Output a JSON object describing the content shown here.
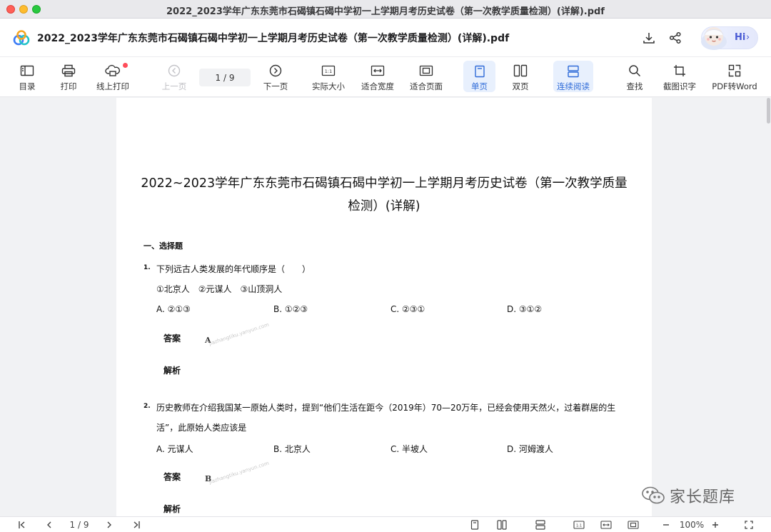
{
  "window": {
    "title": "2022_2023学年广东东莞市石碣镇石碣中学初一上学期月考历史试卷（第一次教学质量检测）(详解).pdf"
  },
  "header": {
    "doc_name": "2022_2023学年广东东莞市石碣镇石碣中学初一上学期月考历史试卷（第一次教学质量检测）(详解).pdf",
    "hi_label": "Hi",
    "icons": [
      "app-logo",
      "download-icon",
      "share-icon",
      "assistant-avatar"
    ]
  },
  "toolbar": {
    "items": [
      {
        "label": "目录",
        "icon": "toc-icon"
      },
      {
        "label": "打印",
        "icon": "print-icon"
      },
      {
        "label": "线上打印",
        "icon": "cloud-print-icon"
      },
      {
        "label": "上一页",
        "icon": "prev-page-icon",
        "disabled": true
      },
      {
        "label": "下一页",
        "icon": "next-page-icon"
      },
      {
        "label": "实际大小",
        "icon": "actual-size-icon"
      },
      {
        "label": "适合宽度",
        "icon": "fit-width-icon"
      },
      {
        "label": "适合页面",
        "icon": "fit-page-icon"
      },
      {
        "label": "单页",
        "icon": "single-page-icon",
        "active": true
      },
      {
        "label": "双页",
        "icon": "double-page-icon"
      },
      {
        "label": "连续阅读",
        "icon": "continuous-icon",
        "active": true
      },
      {
        "label": "查找",
        "icon": "search-icon"
      },
      {
        "label": "截图识字",
        "icon": "screenshot-ocr-icon"
      },
      {
        "label": "PDF转Word",
        "icon": "pdf-to-word-icon"
      }
    ],
    "page_indicator": "1 / 9"
  },
  "document": {
    "title": "2022~2023学年广东东莞市石碣镇石碣中学初一上学期月考历史试卷（第一次教学质量检测）(详解)",
    "section": "一、选择题",
    "questions": [
      {
        "num": "1.",
        "text": "下列远古人类发展的年代顺序是（　　）",
        "subtext": "①北京人　②元谋人　③山顶洞人",
        "options": [
          "A. ②①③",
          "B. ①②③",
          "C. ②③①",
          "D. ③①②"
        ],
        "answer_label": "答案",
        "answer": "A",
        "analysis_label": "解析"
      },
      {
        "num": "2.",
        "text": "历史教师在介绍我国某一原始人类时，提到“他们生活在距今（2019年）70—20万年，已经会使用天然火，过着群居的生活”，此原始人类应该是",
        "options": [
          "A. 元谋人",
          "B. 北京人",
          "C. 半坡人",
          "D. 河姆渡人"
        ],
        "answer_label": "答案",
        "answer": "B",
        "analysis_label": "解析"
      }
    ],
    "watermark": "jiazhangtiku.yanyun.com"
  },
  "statusbar": {
    "page_indicator": "1 / 9",
    "zoom": "100%"
  },
  "overlay": {
    "wechat_label": "家长题库"
  }
}
